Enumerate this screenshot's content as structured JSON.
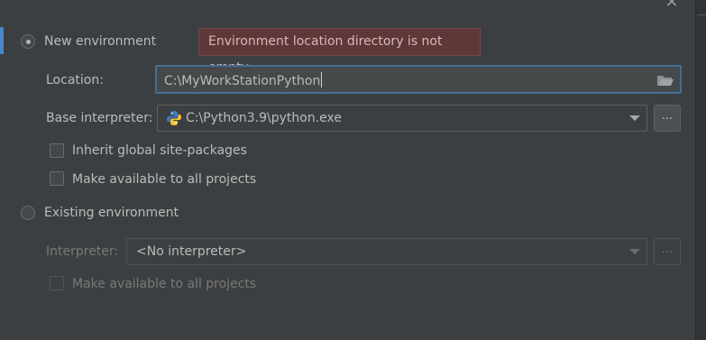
{
  "new_env": {
    "label": "New environment",
    "error_tooltip": "Environment location directory is not empty",
    "location_label": "Location:",
    "location_value": "C:\\MyWorkStationPython",
    "base_interpreter_label": "Base interpreter:",
    "base_interpreter_value": "C:\\Python3.9\\python.exe",
    "base_browse_label": "...",
    "inherit_label": "Inherit global site-packages",
    "make_available_label": "Make available to all projects"
  },
  "existing_env": {
    "label": "Existing environment",
    "interpreter_label": "Interpreter:",
    "interpreter_value": "<No interpreter>",
    "browse_label": "...",
    "make_available_label": "Make available to all projects"
  },
  "icons": {
    "close": "close-icon",
    "folder": "folder-icon",
    "python": "python-icon",
    "dropdown": "chevron-down-icon"
  },
  "colors": {
    "background": "#3c3f41",
    "accent": "#4a88c7",
    "focus_border": "#466d94",
    "error_background": "#5e3838"
  }
}
